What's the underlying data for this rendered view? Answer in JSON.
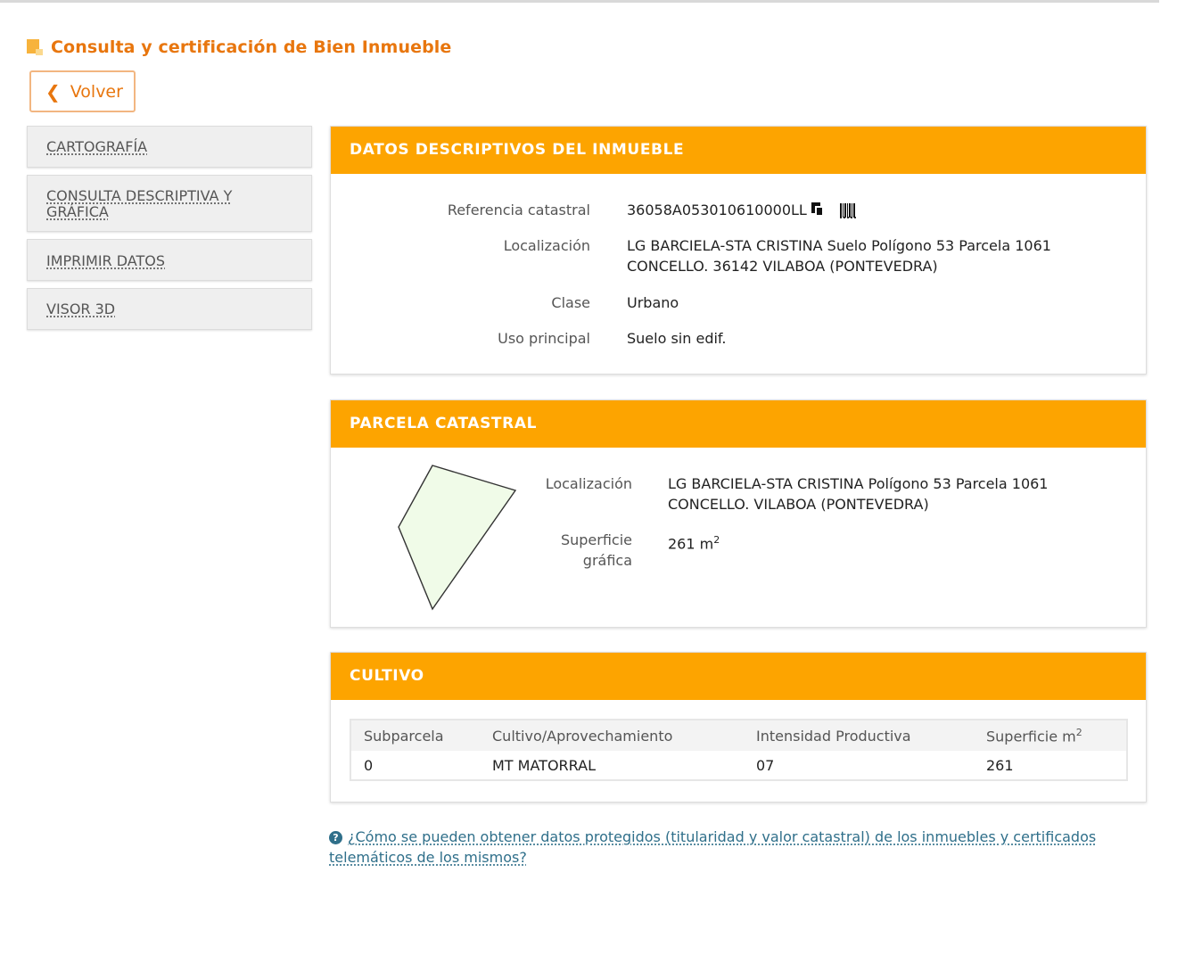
{
  "header": {
    "title": "Consulta y certificación de Bien Inmueble"
  },
  "back_button": {
    "label": "Volver"
  },
  "sidebar": {
    "items": [
      {
        "label": "CARTOGRAFÍA"
      },
      {
        "label": "CONSULTA DESCRIPTIVA Y GRÁFICA"
      },
      {
        "label": "IMPRIMIR DATOS"
      },
      {
        "label": "VISOR 3D"
      }
    ]
  },
  "datos": {
    "title": "DATOS DESCRIPTIVOS DEL INMUEBLE",
    "ref_label": "Referencia catastral",
    "ref_value": "36058A053010610000LL",
    "loc_label": "Localización",
    "loc_line1": "LG BARCIELA-STA CRISTINA Suelo Polígono 53 Parcela 1061",
    "loc_line2": "CONCELLO. 36142 VILABOA (PONTEVEDRA)",
    "clase_label": "Clase",
    "clase_value": "Urbano",
    "uso_label": "Uso principal",
    "uso_value": "Suelo sin edif."
  },
  "parcela": {
    "title": "PARCELA CATASTRAL",
    "loc_label": "Localización",
    "loc_line1": "LG BARCIELA-STA CRISTINA Polígono 53 Parcela 1061",
    "loc_line2": "CONCELLO. VILABOA (PONTEVEDRA)",
    "sup_label_line1": "Superficie",
    "sup_label_line2": "gráfica",
    "sup_value": "261 m",
    "sup_exp": "2",
    "shape_fill": "#f0fbe8"
  },
  "cultivo": {
    "title": "CULTIVO",
    "headers": [
      "Subparcela",
      "Cultivo/Aprovechamiento",
      "Intensidad Productiva",
      "Superficie m"
    ],
    "header_exp": "2",
    "rows": [
      [
        "0",
        "MT MATORRAL",
        "07",
        "261"
      ]
    ]
  },
  "help": {
    "text": "¿Cómo se pueden obtener datos protegidos (titularidad y valor catastral) de los inmuebles y certificados telemáticos de los mismos?"
  },
  "colors": {
    "accent": "#fda400",
    "title": "#e8760e",
    "link": "#2f6f8a"
  },
  "icons": [
    "square-logo-icon",
    "chevron-left-icon",
    "copy-icon",
    "barcode-icon",
    "question-icon"
  ]
}
